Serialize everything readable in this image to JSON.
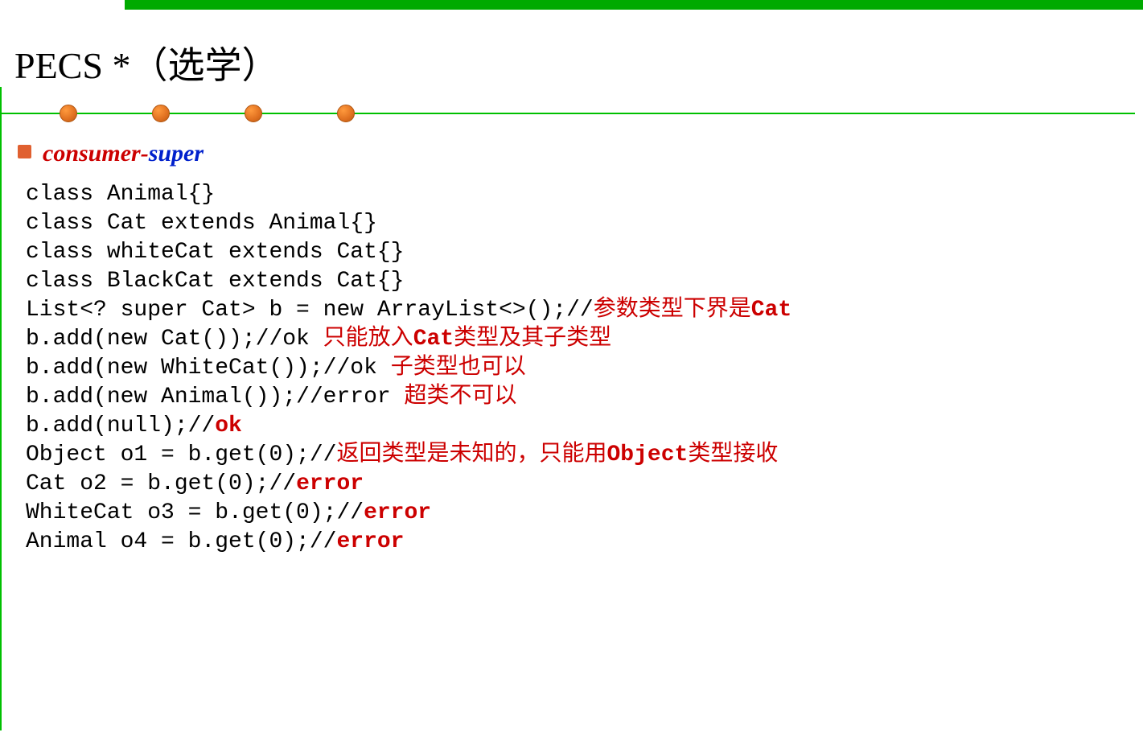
{
  "title": "PECS *（选学）",
  "subtitle": {
    "part1": "consumer",
    "dash": "-",
    "part2": "super"
  },
  "code": {
    "l1": "class Animal{}",
    "l2": "class Cat extends Animal{}",
    "l3": "class whiteCat extends Cat{}",
    "l4": "class BlackCat extends Cat{}",
    "l5": "",
    "l6a": "List<? super Cat> b = new ArrayList<>();//",
    "l6b": "参数类型下界是",
    "l6c": "Cat",
    "l7a": "b.add(new Cat());//ok ",
    "l7b": "只能放入",
    "l7c": "Cat",
    "l7d": "类型及其子类型",
    "l8a": "b.add(new WhiteCat());//ok ",
    "l8b": "子类型也可以",
    "l9a": "b.add(new Animal());//error ",
    "l9b": "超类不可以",
    "l10a": "b.add(null);//",
    "l10b": "ok",
    "l11": "",
    "l12a": "Object o1 = b.get(0);//",
    "l12b": "返回类型是未知的，只能用",
    "l12c": "Object",
    "l12d": "类型接收",
    "l13a": "Cat o2 = b.get(0);//",
    "l13b": "error",
    "l14a": "WhiteCat o3 = b.get(0);//",
    "l14b": "error",
    "l15a": "Animal o4 = b.get(0);//",
    "l15b": "error"
  }
}
